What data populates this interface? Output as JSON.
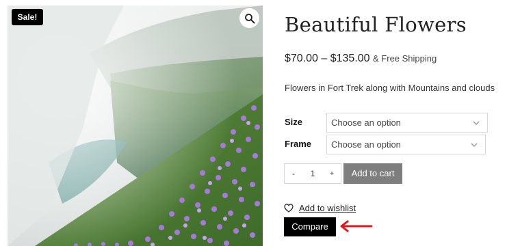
{
  "product": {
    "image_alt": "Flowers on mountain slope with mist",
    "sale_badge": "Sale!",
    "title": "Beautiful Flowers",
    "price_range": "$70.00 – $135.00",
    "shipping_note": "& Free Shipping",
    "description": "Flowers in Fort Trek along with Mountains and clouds"
  },
  "variations": {
    "size": {
      "label": "Size",
      "placeholder": "Choose an option"
    },
    "frame": {
      "label": "Frame",
      "placeholder": "Choose an option"
    }
  },
  "cart": {
    "minus": "-",
    "quantity": "1",
    "plus": "+",
    "add_label": "Add to cart"
  },
  "wishlist_label": "Add to wishlist",
  "compare_label": "Compare",
  "icons": {
    "zoom": "search-icon",
    "wishlist": "heart-icon",
    "dropdown": "chevron-down-icon",
    "annotation": "red-arrow-icon"
  },
  "colors": {
    "sale_badge": "#000000",
    "add_to_cart_bg": "#7e7e7e",
    "compare_bg": "#000000",
    "annotation_arrow": "#e0161b"
  }
}
